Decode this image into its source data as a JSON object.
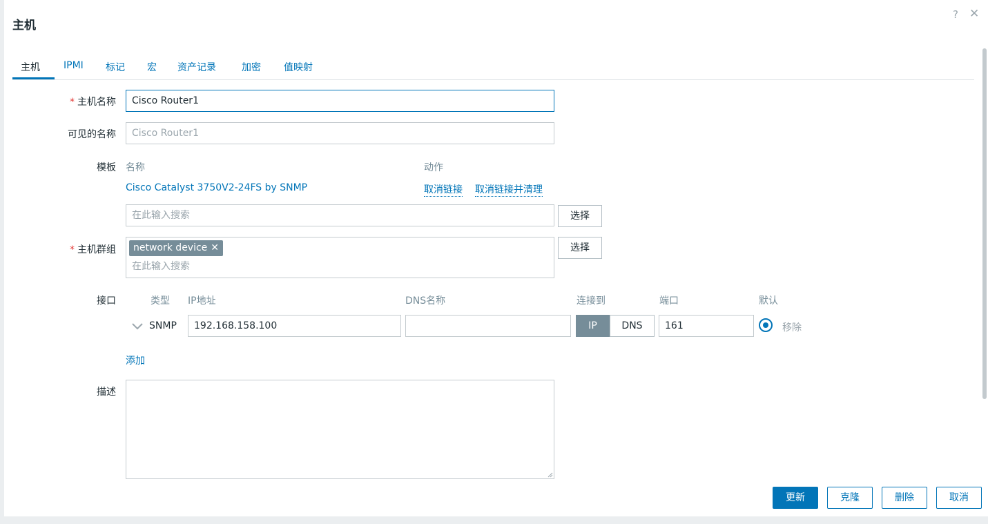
{
  "dialog": {
    "title": "主机"
  },
  "tabs": [
    "主机",
    "IPMI",
    "标记",
    "宏",
    "资产记录",
    "加密",
    "值映射"
  ],
  "form": {
    "host_name": {
      "label": "主机名称",
      "value": "Cisco Router1"
    },
    "visible_name": {
      "label": "可见的名称",
      "placeholder": "Cisco Router1"
    },
    "templates": {
      "label": "模板",
      "col_name": "名称",
      "col_action": "动作",
      "linked_template": "Cisco Catalyst 3750V2-24FS by SNMP",
      "unlink": "取消链接",
      "unlink_and_clear": "取消链接并清理",
      "search_placeholder": "在此输入搜索",
      "select_button": "选择"
    },
    "host_groups": {
      "label": "主机群组",
      "chip": "network device",
      "search_placeholder": "在此输入搜索",
      "select_button": "选择"
    },
    "interfaces": {
      "label": "接口",
      "headers": {
        "type": "类型",
        "ip": "IP地址",
        "dns": "DNS名称",
        "connect_to": "连接到",
        "port": "端口",
        "default": "默认"
      },
      "row": {
        "type": "SNMP",
        "ip": "192.168.158.100",
        "dns": "",
        "connect_ip": "IP",
        "connect_dns": "DNS",
        "port": "161",
        "remove": "移除"
      },
      "add_link": "添加"
    },
    "description": {
      "label": "描述",
      "value": ""
    }
  },
  "footer": {
    "update": "更新",
    "clone": "克隆",
    "delete": "删除",
    "cancel": "取消"
  },
  "colors": {
    "accent": "#0275b8",
    "required": "#e33734",
    "chip": "#768d99"
  }
}
